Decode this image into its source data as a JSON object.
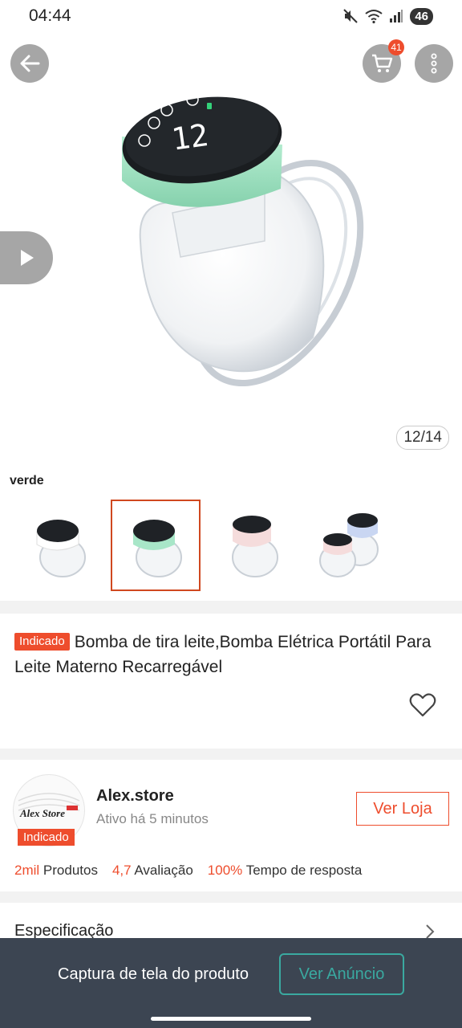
{
  "status_bar": {
    "time": "04:44",
    "battery": "46"
  },
  "header": {
    "cart_count": "41"
  },
  "gallery": {
    "counter": "12/14"
  },
  "variant": {
    "label": "verde"
  },
  "product": {
    "tag": "Indicado",
    "title": "Bomba de tira leite,Bomba Elétrica Portátil Para Leite Materno Recarregável"
  },
  "store": {
    "logo_text": "Alex Store",
    "tag": "Indicado",
    "name": "Alex.store",
    "active": "Ativo há 5 minutos",
    "button": "Ver Loja",
    "stats": [
      {
        "value": "2mil",
        "label": "Produtos"
      },
      {
        "value": "4,7",
        "label": "Avaliação"
      },
      {
        "value": "100%",
        "label": "Tempo de resposta"
      }
    ]
  },
  "spec": {
    "label": "Especificação"
  },
  "bottom_bar": {
    "text": "Captura de tela do produto",
    "button": "Ver Anúncio"
  },
  "colors": {
    "accent": "#ee4d2d",
    "bottom_bar": "#3c4552",
    "teal": "#3aa9a0",
    "mint": "#a8e6c8"
  }
}
